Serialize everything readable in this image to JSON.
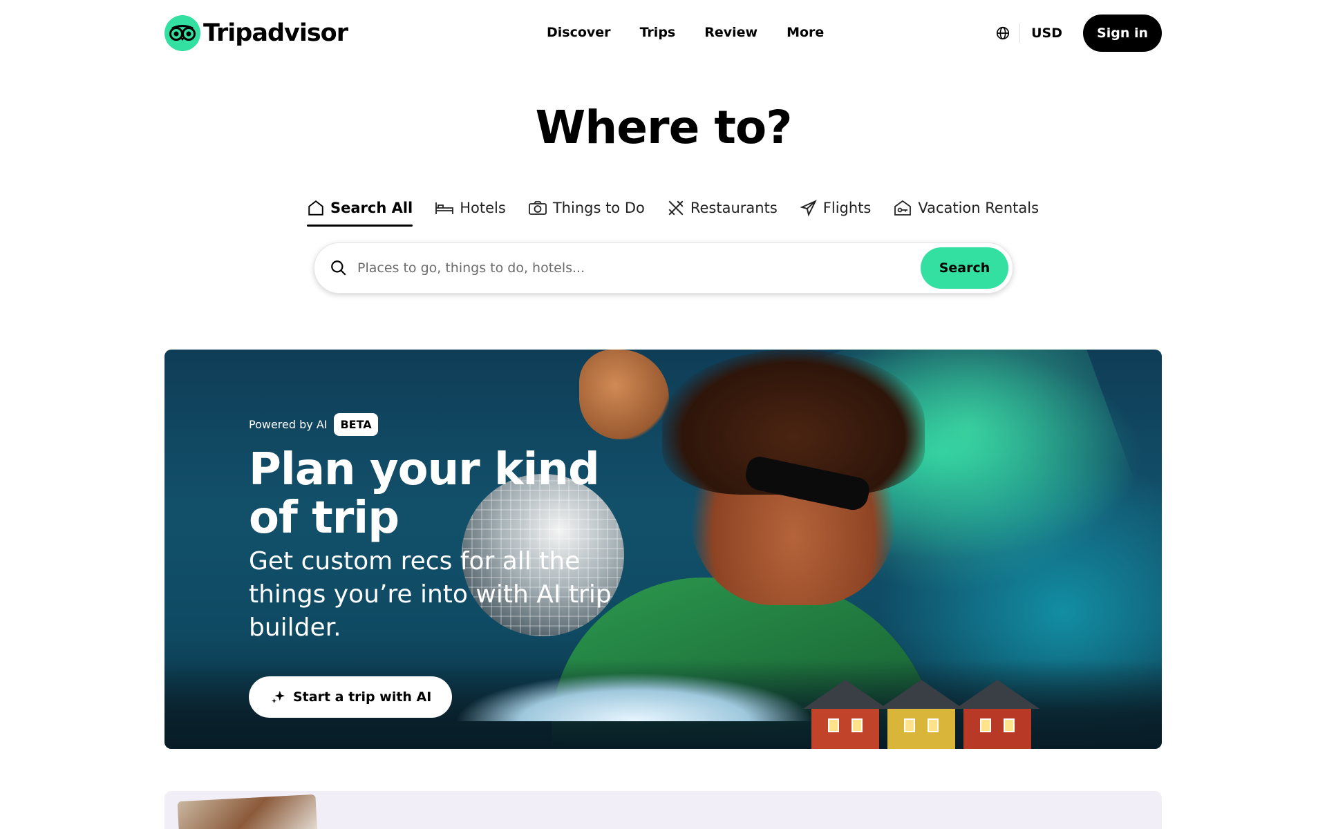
{
  "brand": {
    "name": "Tripadvisor",
    "accent": "#34e0a1"
  },
  "nav": {
    "items": [
      "Discover",
      "Trips",
      "Review",
      "More"
    ]
  },
  "header": {
    "currency": "USD",
    "sign_in": "Sign in",
    "globe_icon": "globe-icon"
  },
  "hero": {
    "title": "Where to?"
  },
  "tabs": [
    {
      "label": "Search All",
      "icon": "home-icon",
      "active": true
    },
    {
      "label": "Hotels",
      "icon": "bed-icon",
      "active": false
    },
    {
      "label": "Things to Do",
      "icon": "camera-icon",
      "active": false
    },
    {
      "label": "Restaurants",
      "icon": "utensils-icon",
      "active": false
    },
    {
      "label": "Flights",
      "icon": "plane-icon",
      "active": false
    },
    {
      "label": "Vacation Rentals",
      "icon": "house-key-icon",
      "active": false
    }
  ],
  "search": {
    "placeholder": "Places to go, things to do, hotels...",
    "button": "Search"
  },
  "banner": {
    "powered_by": "Powered by AI",
    "badge": "BETA",
    "title": "Plan your kind of trip",
    "subtitle": "Get custom recs for all the things you’re into with AI trip builder.",
    "cta": "Start a trip with AI"
  },
  "colors": {
    "search_button": "#34e0a1",
    "sign_in_bg": "#000000",
    "next_card_bg": "#f2eef8"
  }
}
